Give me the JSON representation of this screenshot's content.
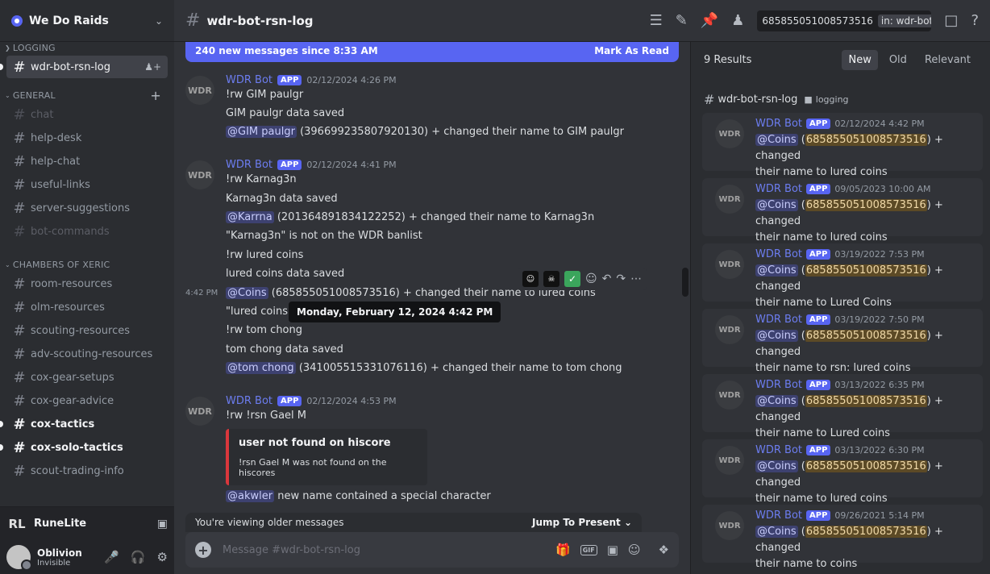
{
  "sidebar": {
    "server_name": "We Do Raids",
    "categories": [
      {
        "label": "LOGGING"
      },
      {
        "label": "GENERAL"
      },
      {
        "label": "CHAMBERS OF XERIC"
      }
    ],
    "channels": {
      "logging": [
        {
          "label": "wdr-bot-rsn-log"
        }
      ],
      "general": [
        {
          "label": "chat"
        },
        {
          "label": "help-desk"
        },
        {
          "label": "help-chat"
        },
        {
          "label": "useful-links"
        },
        {
          "label": "server-suggestions"
        },
        {
          "label": "bot-commands"
        }
      ],
      "cox": [
        {
          "label": "room-resources"
        },
        {
          "label": "olm-resources"
        },
        {
          "label": "scouting-resources"
        },
        {
          "label": "adv-scouting-resources"
        },
        {
          "label": "cox-gear-setups"
        },
        {
          "label": "cox-gear-advice"
        },
        {
          "label": "cox-tactics"
        },
        {
          "label": "cox-solo-tactics"
        },
        {
          "label": "scout-trading-info"
        }
      ]
    },
    "voice_app": "RuneLite",
    "user": {
      "name": "Oblivion",
      "status": "Invisible"
    }
  },
  "topbar": {
    "channel": "wdr-bot-rsn-log",
    "search_query": "685855051008573516",
    "search_scope": "in: wdr-bot"
  },
  "chat": {
    "new_messages": "240 new messages since 8:33 AM",
    "mark_read": "Mark As Read",
    "bot_name": "WDR Bot",
    "app_tag": "APP",
    "tooltip": "Monday, February 12, 2024 4:42 PM",
    "hover_time": "4:42 PM",
    "messages": [
      {
        "ts": "02/12/2024 4:26 PM",
        "l1": "!rw GIM paulgr",
        "l2": "GIM paulgr data saved",
        "mention": "@GIM paulgr",
        "l3": " (396699235807920130) + changed their name to GIM paulgr"
      },
      {
        "ts": "02/12/2024 4:41 PM",
        "l1": "!rw Karnag3n",
        "l2": "Karnag3n data saved",
        "mention": "@Karrna",
        "l3": " (201364891834122252) + changed their name to Karnag3n",
        "l4": "\"Karnag3n\" is not on the WDR banlist",
        "l5": "!rw lured coins",
        "l6": "lured coins data saved"
      },
      {
        "mention": "@Coins",
        "l1": " (685855051008573516) + changed their name to lured coins",
        "l2": "\"lured coins\" is not on the WDR banlist",
        "l3": "!rw tom chong",
        "l4": "tom chong data saved",
        "mention2": "@tom chong",
        "l5": " (341005515331076116) + changed their name to tom chong"
      },
      {
        "ts": "02/12/2024 4:53 PM",
        "l1": "!rw !rsn Gael M",
        "embed_title": "user not found on hiscore",
        "embed_desc": "!rsn Gael M was not found on the hiscores",
        "mention": "@akwler",
        "l2": " new name contained a special character"
      }
    ],
    "older_notice": "You're viewing older messages",
    "jump": "Jump To Present",
    "composer_placeholder": "Message #wdr-bot-rsn-log"
  },
  "results": {
    "count": "9 Results",
    "sort": [
      "New",
      "Old",
      "Relevant"
    ],
    "channel": "wdr-bot-rsn-log",
    "category": "logging",
    "mention": "@Coins",
    "id": "685855051008573516",
    "mid_text": " + changed",
    "items": [
      {
        "ts": "02/12/2024 4:42 PM",
        "rest": "their name to lured coins"
      },
      {
        "ts": "09/05/2023 10:00 AM",
        "rest": "their name to lured coins"
      },
      {
        "ts": "03/19/2022 7:53 PM",
        "rest": "their name to Lured Coins"
      },
      {
        "ts": "03/19/2022 7:50 PM",
        "rest": "their name to rsn: lured coins"
      },
      {
        "ts": "03/13/2022 6:35 PM",
        "rest": "their name to Lured coins"
      },
      {
        "ts": "03/13/2022 6:30 PM",
        "rest": "their name to lured coins"
      },
      {
        "ts": "09/26/2021 5:14 PM",
        "rest": "their name to coins"
      }
    ]
  },
  "colors": {
    "accent": "#5865f2",
    "highlight": "#5c4a26",
    "danger": "#da373c"
  }
}
